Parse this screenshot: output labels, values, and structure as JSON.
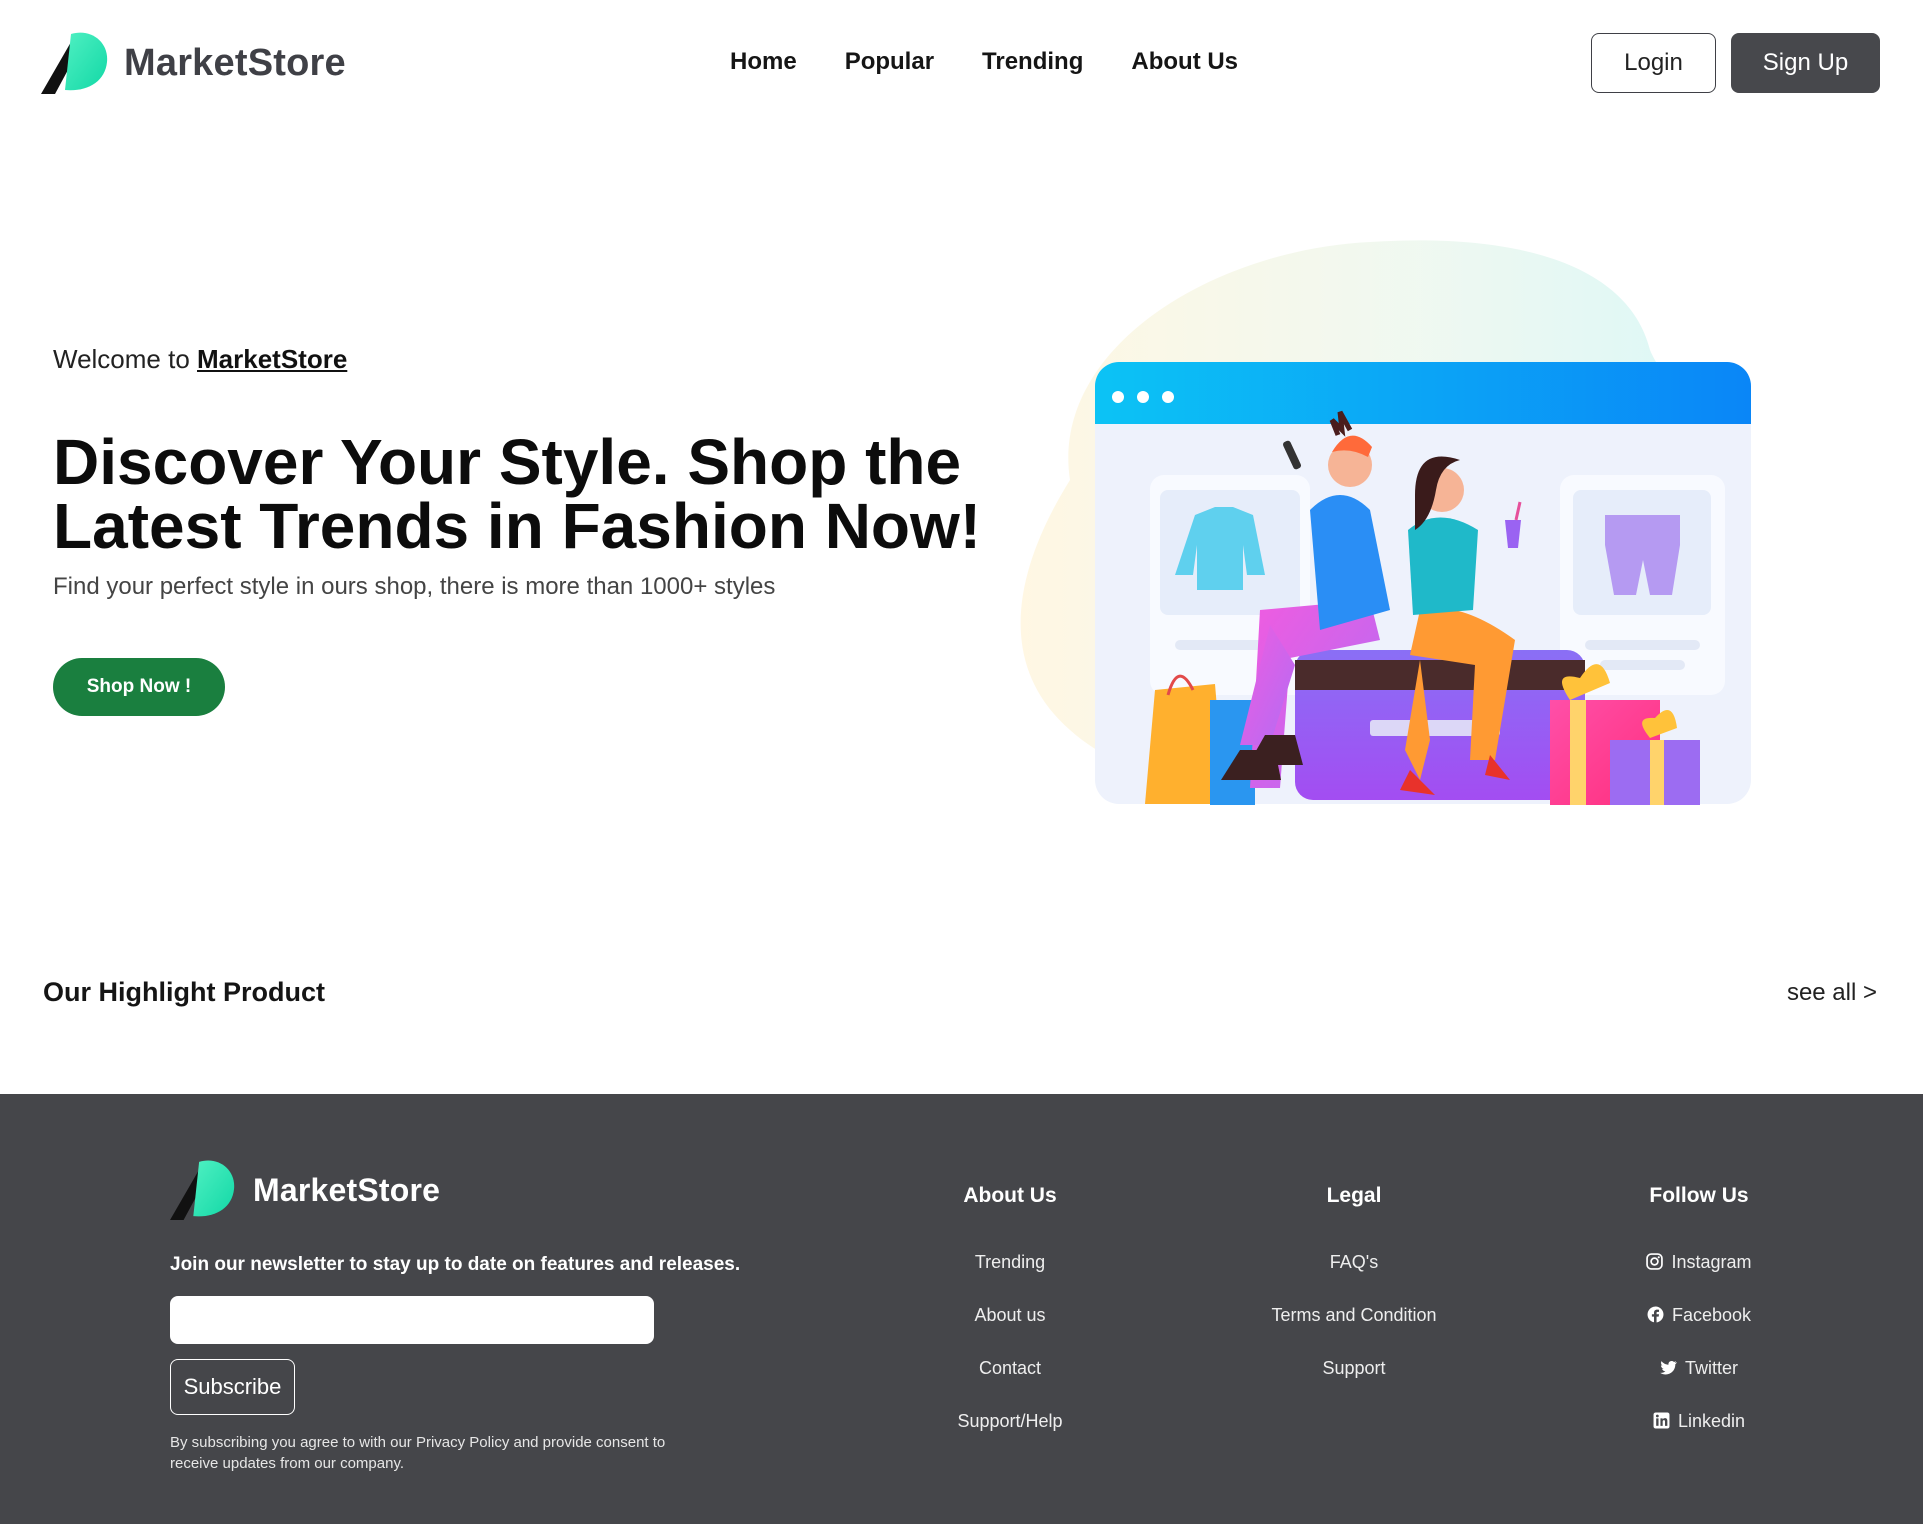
{
  "header": {
    "brand": "MarketStore",
    "nav": [
      "Home",
      "Popular",
      "Trending",
      "About Us"
    ],
    "login_label": "Login",
    "signup_label": "Sign Up"
  },
  "hero": {
    "welcome_prefix": "Welcome to ",
    "welcome_brand": "MarketStore",
    "title": "Discover Your Style. Shop the Latest Trends in Fashion Now!",
    "subtitle": "Find your perfect style in ours shop, there is more than 1000+ styles",
    "cta_label": "Shop Now !"
  },
  "highlight": {
    "title": "Our Highlight Product",
    "see_all": "see all >"
  },
  "footer": {
    "brand": "MarketStore",
    "newsletter_text": "Join our newsletter to stay up to date on features and releases.",
    "email_value": "",
    "subscribe_label": "Subscribe",
    "disclaimer": "By subscribing you agree to with our Privacy Policy and provide consent to receive updates from our company.",
    "columns": {
      "about": {
        "title": "About Us",
        "links": [
          "Trending",
          "About us",
          "Contact",
          "Support/Help"
        ]
      },
      "legal": {
        "title": "Legal",
        "links": [
          "FAQ's",
          "Terms and Condition",
          "Support"
        ]
      },
      "follow": {
        "title": "Follow Us",
        "links": [
          "Instagram",
          "Facebook",
          "Twitter",
          "Linkedin"
        ]
      }
    }
  },
  "colors": {
    "dark": "#45464a",
    "accent_green": "#1a7f3f",
    "logo_mint": "#2ee8b6"
  },
  "icons": [
    "logo-mark",
    "instagram-icon",
    "facebook-icon",
    "twitter-icon",
    "linkedin-icon"
  ]
}
